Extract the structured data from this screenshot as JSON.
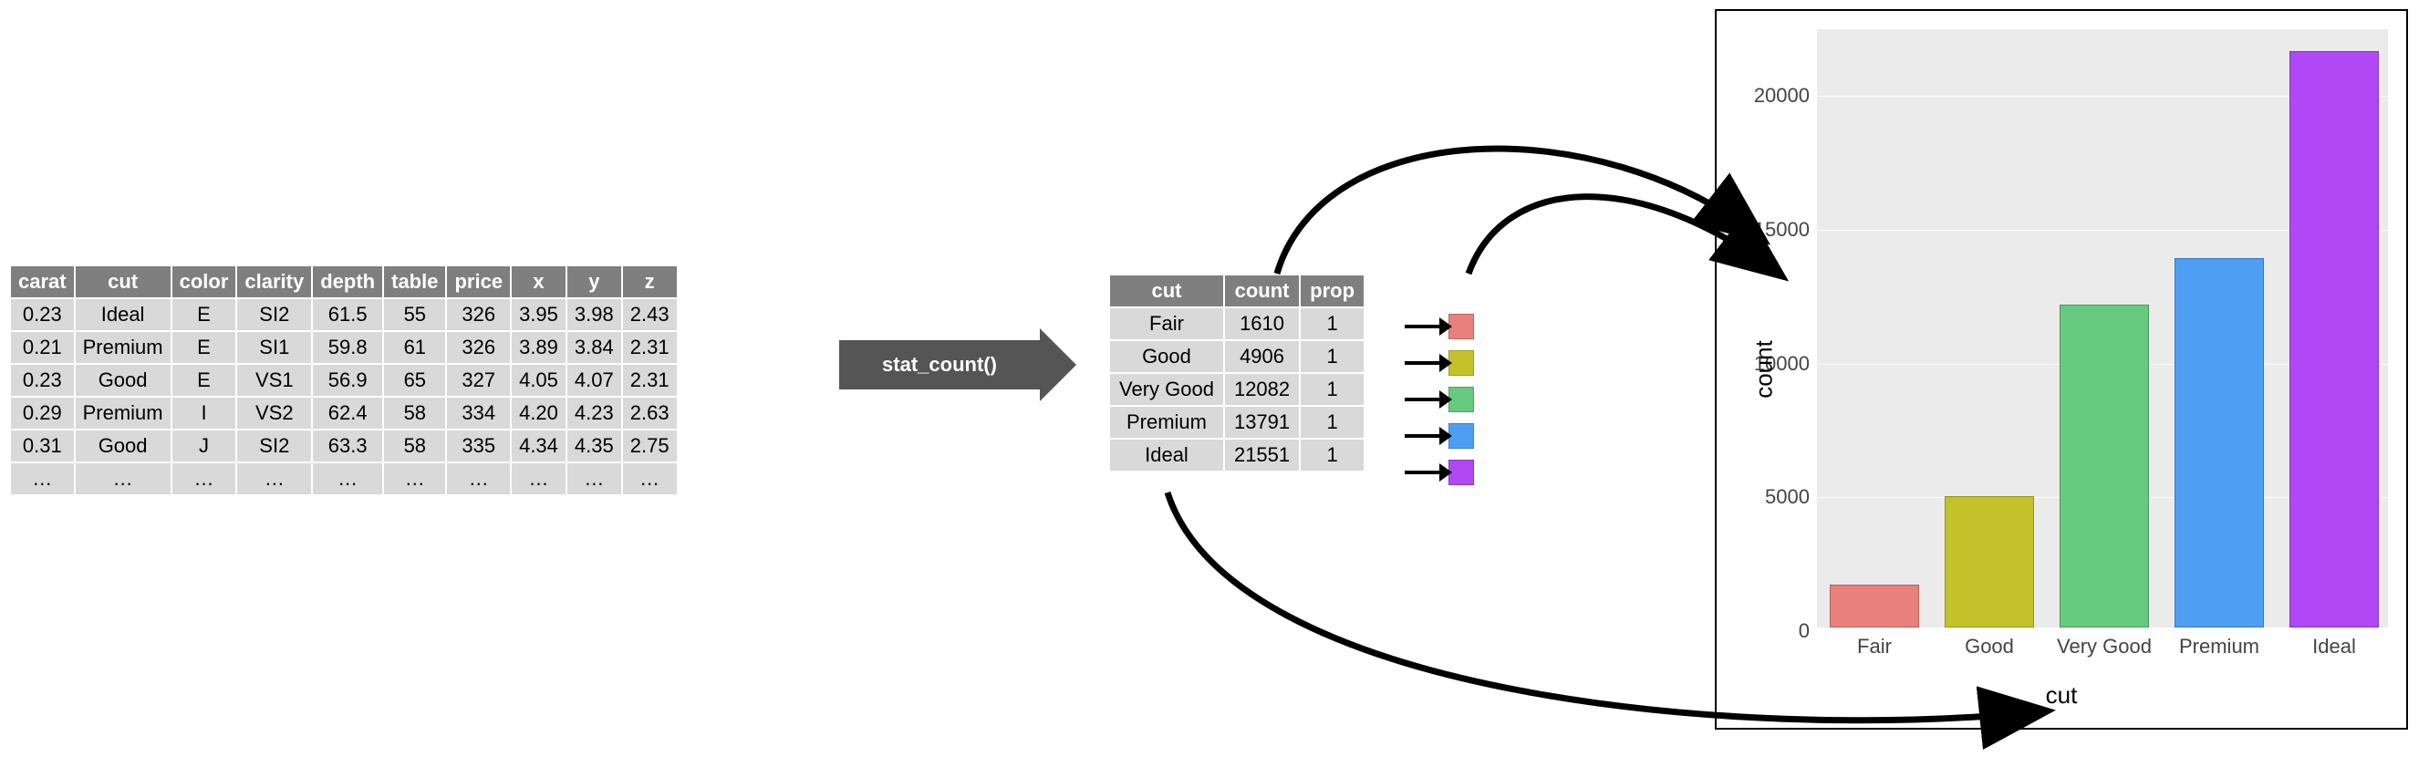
{
  "table1": {
    "headers": [
      "carat",
      "cut",
      "color",
      "clarity",
      "depth",
      "table",
      "price",
      "x",
      "y",
      "z"
    ],
    "rows": [
      [
        "0.23",
        "Ideal",
        "E",
        "SI2",
        "61.5",
        "55",
        "326",
        "3.95",
        "3.98",
        "2.43"
      ],
      [
        "0.21",
        "Premium",
        "E",
        "SI1",
        "59.8",
        "61",
        "326",
        "3.89",
        "3.84",
        "2.31"
      ],
      [
        "0.23",
        "Good",
        "E",
        "VS1",
        "56.9",
        "65",
        "327",
        "4.05",
        "4.07",
        "2.31"
      ],
      [
        "0.29",
        "Premium",
        "I",
        "VS2",
        "62.4",
        "58",
        "334",
        "4.20",
        "4.23",
        "2.63"
      ],
      [
        "0.31",
        "Good",
        "J",
        "SI2",
        "63.3",
        "58",
        "335",
        "4.34",
        "4.35",
        "2.75"
      ],
      [
        "…",
        "…",
        "…",
        "…",
        "…",
        "…",
        "…",
        "…",
        "…",
        "…"
      ]
    ]
  },
  "stat_label": "stat_count()",
  "table2": {
    "headers": [
      "cut",
      "count",
      "prop"
    ],
    "rows": [
      {
        "cut": "Fair",
        "count": "1610",
        "prop": "1",
        "color": "#e8817b"
      },
      {
        "cut": "Good",
        "count": "4906",
        "prop": "1",
        "color": "#c3c329"
      },
      {
        "cut": "Very Good",
        "count": "12082",
        "prop": "1",
        "color": "#66ca7f"
      },
      {
        "cut": "Premium",
        "count": "13791",
        "prop": "1",
        "color": "#4e9ff4"
      },
      {
        "cut": "Ideal",
        "count": "21551",
        "prop": "1",
        "color": "#b048f6"
      }
    ]
  },
  "chart_data": {
    "type": "bar",
    "categories": [
      "Fair",
      "Good",
      "Very Good",
      "Premium",
      "Ideal"
    ],
    "values": [
      1610,
      4906,
      12082,
      13791,
      21551
    ],
    "colors": [
      "#e8817b",
      "#c3c329",
      "#66ca7f",
      "#4e9ff4",
      "#b048f6"
    ],
    "title": "",
    "xlabel": "cut",
    "ylabel": "count",
    "ylim": [
      0,
      22500
    ],
    "yticks": [
      0,
      5000,
      10000,
      15000,
      20000
    ]
  }
}
